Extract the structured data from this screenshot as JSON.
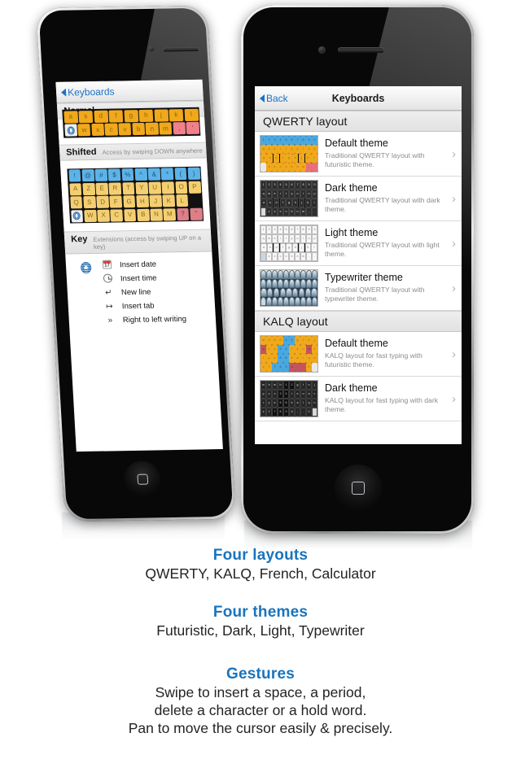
{
  "left_phone": {
    "nav": {
      "back_label": "Keyboards"
    },
    "sections": [
      {
        "title": "Normal",
        "hint": ""
      },
      {
        "title": "Shifted",
        "hint": "Access by swiping DOWN anywhere"
      },
      {
        "title": "Key",
        "hint": "Extensions (access by swiping UP on a key)"
      }
    ],
    "normal_keyboard": {
      "row2": [
        "a",
        "s",
        "d",
        "f",
        "g",
        "h",
        "j",
        "k",
        "l"
      ],
      "row3": [
        "w",
        "x",
        "c",
        "v",
        "b",
        "n",
        "m",
        ",",
        "'"
      ]
    },
    "shifted_keyboard": {
      "row1": [
        "!",
        "@",
        "#",
        "$",
        "%",
        "^",
        "&",
        "*",
        "(",
        ")"
      ],
      "row2": [
        "A",
        "Z",
        "E",
        "R",
        "T",
        "Y",
        "U",
        "I",
        "O",
        "P"
      ],
      "row3": [
        "Q",
        "S",
        "D",
        "F",
        "G",
        "H",
        "J",
        "K",
        "L"
      ],
      "row4": [
        "W",
        "X",
        "C",
        "V",
        "B",
        "N",
        "M",
        "?",
        "\""
      ]
    },
    "extensions": [
      {
        "icon": "calendar-icon",
        "label": "Insert date"
      },
      {
        "icon": "clock-icon",
        "label": "Insert time"
      },
      {
        "icon": "return-arrow-icon",
        "label": "New line"
      },
      {
        "icon": "tab-arrow-icon",
        "label": "Insert tab"
      },
      {
        "icon": "double-chevron-icon",
        "label": "Right to left writing"
      }
    ],
    "globe_key": "globe-icon"
  },
  "right_phone": {
    "nav": {
      "back_label": "Back",
      "title": "Keyboards"
    },
    "sections": [
      {
        "title": "QWERTY layout",
        "rows": [
          {
            "title": "Default theme",
            "subtitle": "Traditional QWERTY layout with futuristic theme.",
            "theme": "futuristic"
          },
          {
            "title": "Dark theme",
            "subtitle": "Traditional QWERTY layout with dark theme.",
            "theme": "dark"
          },
          {
            "title": "Light theme",
            "subtitle": "Traditional QWERTY layout with light theme.",
            "theme": "light"
          },
          {
            "title": "Typewriter theme",
            "subtitle": "Traditional QWERTY layout with typewriter theme.",
            "theme": "typewriter"
          }
        ]
      },
      {
        "title": "KALQ layout",
        "rows": [
          {
            "title": "Default theme",
            "subtitle": "KALQ layout for fast typing with futuristic theme.",
            "theme": "kalq-futuristic"
          },
          {
            "title": "Dark theme",
            "subtitle": "KALQ layout for fast typing with dark theme.",
            "theme": "kalq-dark"
          }
        ]
      }
    ],
    "disclosure_icon": "chevron-right-icon"
  },
  "marketing": {
    "blocks": [
      {
        "heading": "Four layouts",
        "lines": [
          "QWERTY, KALQ, French, Calculator"
        ]
      },
      {
        "heading": "Four themes",
        "lines": [
          "Futuristic, Dark, Light, Typewriter"
        ]
      },
      {
        "heading": "Gestures",
        "lines": [
          "Swipe to insert a space, a period,",
          "delete a character or a hold word.",
          "Pan to move the cursor easily & precisely."
        ]
      }
    ]
  },
  "colors": {
    "accent": "#1a74bd",
    "ios_blue": "#1b72c6",
    "body_text": "#232323"
  }
}
